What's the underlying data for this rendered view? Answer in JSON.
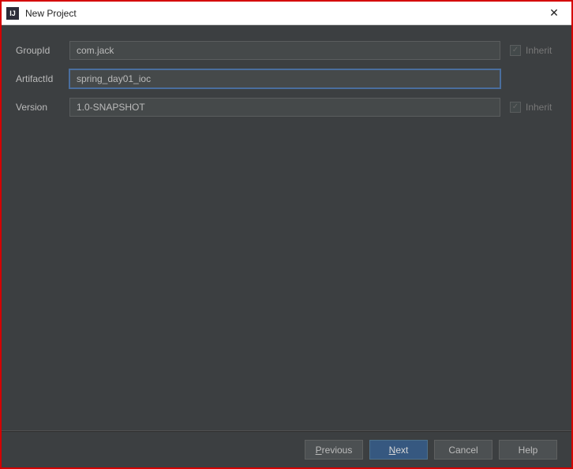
{
  "window": {
    "title": "New Project",
    "icon_text": "IJ"
  },
  "form": {
    "groupId": {
      "label": "GroupId",
      "value": "com.jack",
      "inherit_label": "Inherit",
      "inherit_checked": true
    },
    "artifactId": {
      "label": "ArtifactId",
      "value": "spring_day01_ioc"
    },
    "version": {
      "label": "Version",
      "value": "1.0-SNAPSHOT",
      "inherit_label": "Inherit",
      "inherit_checked": true
    }
  },
  "buttons": {
    "previous_mnemonic": "P",
    "previous_rest": "revious",
    "next_mnemonic": "N",
    "next_rest": "ext",
    "cancel": "Cancel",
    "help": "Help"
  }
}
